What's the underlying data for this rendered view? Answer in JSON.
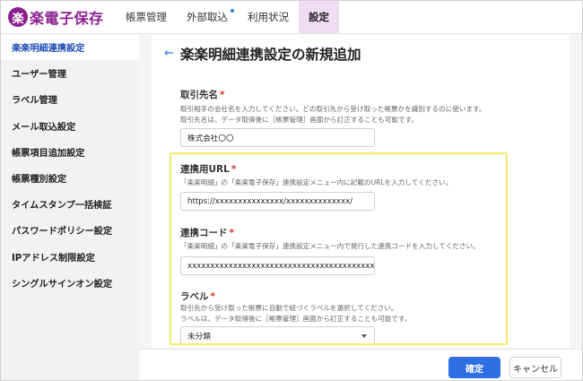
{
  "app": {
    "logo_mark": "楽",
    "logo_text": "楽電子保存"
  },
  "nav": {
    "items": [
      {
        "label": "帳票管理"
      },
      {
        "label": "外部取込"
      },
      {
        "label": "利用状況"
      },
      {
        "label": "設定"
      }
    ]
  },
  "sidebar": {
    "items": [
      {
        "label": "楽楽明細連携設定"
      },
      {
        "label": "ユーザー管理"
      },
      {
        "label": "ラベル管理"
      },
      {
        "label": "メール取込設定"
      },
      {
        "label": "帳票項目追加設定"
      },
      {
        "label": "帳票種別設定"
      },
      {
        "label": "タイムスタンプ一括検証"
      },
      {
        "label": "パスワードポリシー設定"
      },
      {
        "label": "IPアドレス制限設定"
      },
      {
        "label": "シングルサインオン設定"
      }
    ]
  },
  "page": {
    "back_arrow": "←",
    "title": "楽楽明細連携設定の新規追加"
  },
  "form": {
    "required_mark": "*",
    "client_name": {
      "label": "取引先名",
      "help1": "取引相手の会社名を入力してください。どの取引先から受け取った帳票かを識別するのに使います。",
      "help2": "取引先名は、データ取得後に［帳票管理］画面から訂正することも可能です。",
      "value": "株式会社〇〇"
    },
    "url": {
      "label": "連携用URL",
      "help": "「楽楽明細」の「楽楽電子保存」連携設定メニュー内に記載のURLを入力してください。",
      "value": "https://xxxxxxxxxxxxxxx/xxxxxxxxxxxxxx/"
    },
    "code": {
      "label": "連携コード",
      "help": "「楽楽明細」の「楽楽電子保存」連携設定メニュー内で発行した連携コードを入力してください。",
      "value": "xxxxxxxxxxxxxxxxxxxxxxxxxxxxxxxxxxxxxxxxxxxxxx"
    },
    "label_field": {
      "label": "ラベル",
      "help1": "取引先から受け取った帳票に自動で紐づくラベルを選択してください。",
      "help2": "ラベルは、データ取得後に［帳票管理］画面から訂正することも可能です。",
      "value": "未分類"
    }
  },
  "footer": {
    "confirm_label": "確定",
    "cancel_label": "キャンセル"
  },
  "colors": {
    "brand": "#8b1f8f",
    "accent": "#2f6fe4",
    "highlight": "#f5e96a",
    "nav_active_bg": "#f1ddf3"
  }
}
